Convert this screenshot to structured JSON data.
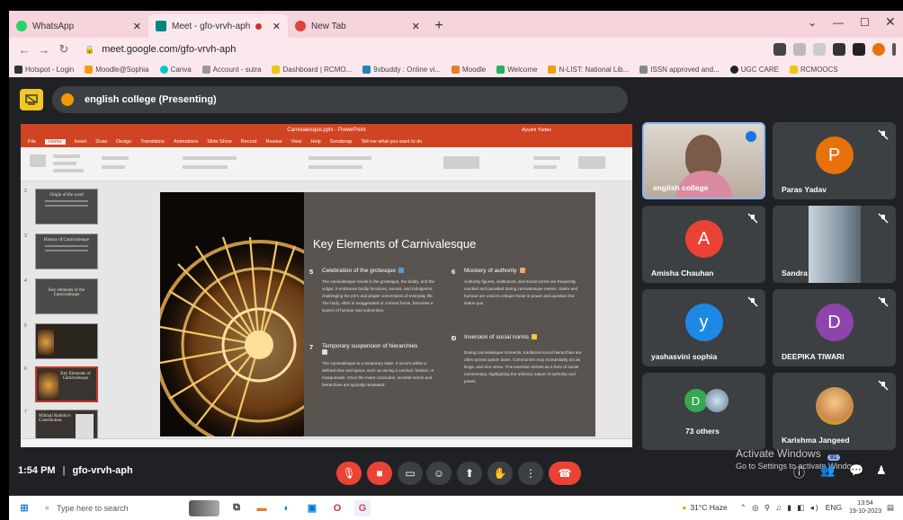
{
  "browser": {
    "tabs": [
      {
        "title": "WhatsApp",
        "icon": "whatsapp-icon",
        "color": "#25d366"
      },
      {
        "title": "Meet - gfo-vrvh-aph",
        "icon": "google-meet-icon",
        "color": "#00897b"
      },
      {
        "title": "New Tab",
        "icon": "chrome-icon",
        "color": "#db4437"
      }
    ],
    "new_tab": "+",
    "url": "meet.google.com/gfo-vrvh-aph",
    "bookmarks": [
      "Hotspot - Login",
      "Moodle@Sophia",
      "Canva",
      "Account - sutra",
      "Dashboard | RCMO...",
      "9xbuddy : Online vi...",
      "Moodle",
      "Welcome",
      "N-LIST: National Lib...",
      "ISSN approved and...",
      "UGC CARE",
      "RCMOOCS"
    ]
  },
  "meet": {
    "presenting_label": "english college (Presenting)",
    "meeting_time": "1:54 PM",
    "meeting_code": "gfo-vrvh-aph",
    "participant_badge": "81",
    "activate_line1": "Activate Windows",
    "activate_line2": "Go to Settings to activate Windows."
  },
  "powerpoint": {
    "title": "Carnivalesque.pptx - PowerPoint",
    "user": "Ayushi Yadav",
    "tell_me": "Tell me what you want to do",
    "menus": [
      "File",
      "Home",
      "Insert",
      "Draw",
      "Design",
      "Transitions",
      "Animations",
      "Slide Show",
      "Record",
      "Review",
      "View",
      "Help",
      "Sendsnap"
    ],
    "thumbnails": [
      {
        "num": "2",
        "title": "Origin of the word"
      },
      {
        "num": "3",
        "title": "History of Carnivalesque"
      },
      {
        "num": "4",
        "title": "Key elements of the Carnivalesque"
      },
      {
        "num": "5",
        "title": ""
      },
      {
        "num": "6",
        "title": "Key Elements of Carnivalesque"
      },
      {
        "num": "7",
        "title": "Mikhail Bakhtin's Contribution"
      }
    ],
    "slide": {
      "title": "Key Elements of Carnivalesque",
      "points": [
        {
          "num": "5",
          "heading": "Celebration of the grotesque",
          "body": "The carnivalesque revels in the grotesque, the bodily, and the vulgar. It embraces bodily functions, excess, and indulgence, challenging the prim and proper conventions of everyday life. The body, often in exaggerated or comical forms, becomes a source of humour and subversion."
        },
        {
          "num": "6",
          "heading": "Mockery of authority",
          "body": "Authority figures, institutions, and social norms are frequently mocked and parodied during carnivalesque events. Satire and humour are used to critique those in power and question the status quo."
        },
        {
          "num": "7",
          "heading": "Temporary suspension of hierarchies",
          "body": "The carnivalesque is a temporary state. It occurs within a defined time and space, such as during a carnival, festival, or masquerade. Once the event concludes, societal norms and hierarchies are typically reinstated."
        },
        {
          "num": "Ð",
          "heading": "Inversion of social norms",
          "body": "During carnivalesque moments, traditional social hierarchies are often turned upside down. Commoners may momentarily act as kings, and vice versa. This inversion serves as a form of social commentary, highlighting the arbitrary nature of authority and power."
        }
      ]
    }
  },
  "participants": [
    {
      "name": "english college",
      "initial": "",
      "color": "#c7c2bb",
      "speaking": true
    },
    {
      "name": "Paras Yadav",
      "initial": "P",
      "color": "#e8710a"
    },
    {
      "name": "Amisha Chauhan",
      "initial": "A",
      "color": "#ea4335"
    },
    {
      "name": "Sandra",
      "initial": "",
      "color": "#8a9aa8"
    },
    {
      "name": "yashasvini sophia",
      "initial": "y",
      "color": "#1e88e5"
    },
    {
      "name": "DEEPIKA TIWARI",
      "initial": "D",
      "color": "#8e44ad"
    },
    {
      "name": "73 others",
      "initial": "D",
      "color": "#34a853"
    },
    {
      "name": "Karishma Jangeed",
      "initial": "",
      "color": "#f4b400"
    }
  ],
  "taskbar": {
    "search_placeholder": "Type here to search",
    "weather": "31°C Haze",
    "language": "ENG",
    "time": "13:54",
    "date": "19-10-2023"
  }
}
